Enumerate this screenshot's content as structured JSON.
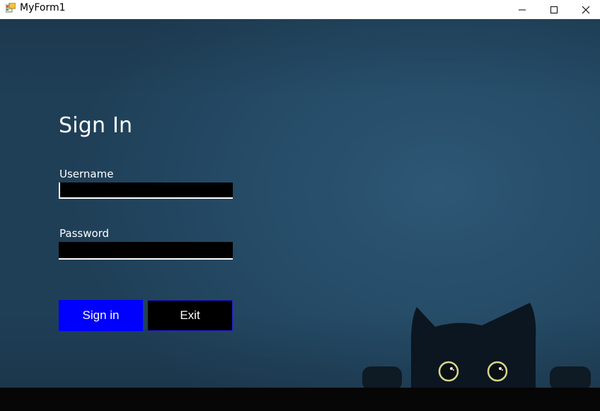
{
  "window": {
    "title": "MyForm1",
    "icon": "winforms-app-icon",
    "controls": [
      "minimize-icon",
      "maximize-icon",
      "close-icon"
    ]
  },
  "form": {
    "heading": "Sign In",
    "username": {
      "label": "Username",
      "value": "",
      "placeholder": ""
    },
    "password": {
      "label": "Password",
      "value": "",
      "placeholder": ""
    },
    "signin_label": "Sign in",
    "exit_label": "Exit"
  },
  "colors": {
    "background": "#264d69",
    "signin_button": "#0000ff",
    "exit_button": "#000000",
    "input_background": "#000000",
    "text": "#ffffff"
  },
  "decor": {
    "illustration": "black-cat-peeking"
  }
}
